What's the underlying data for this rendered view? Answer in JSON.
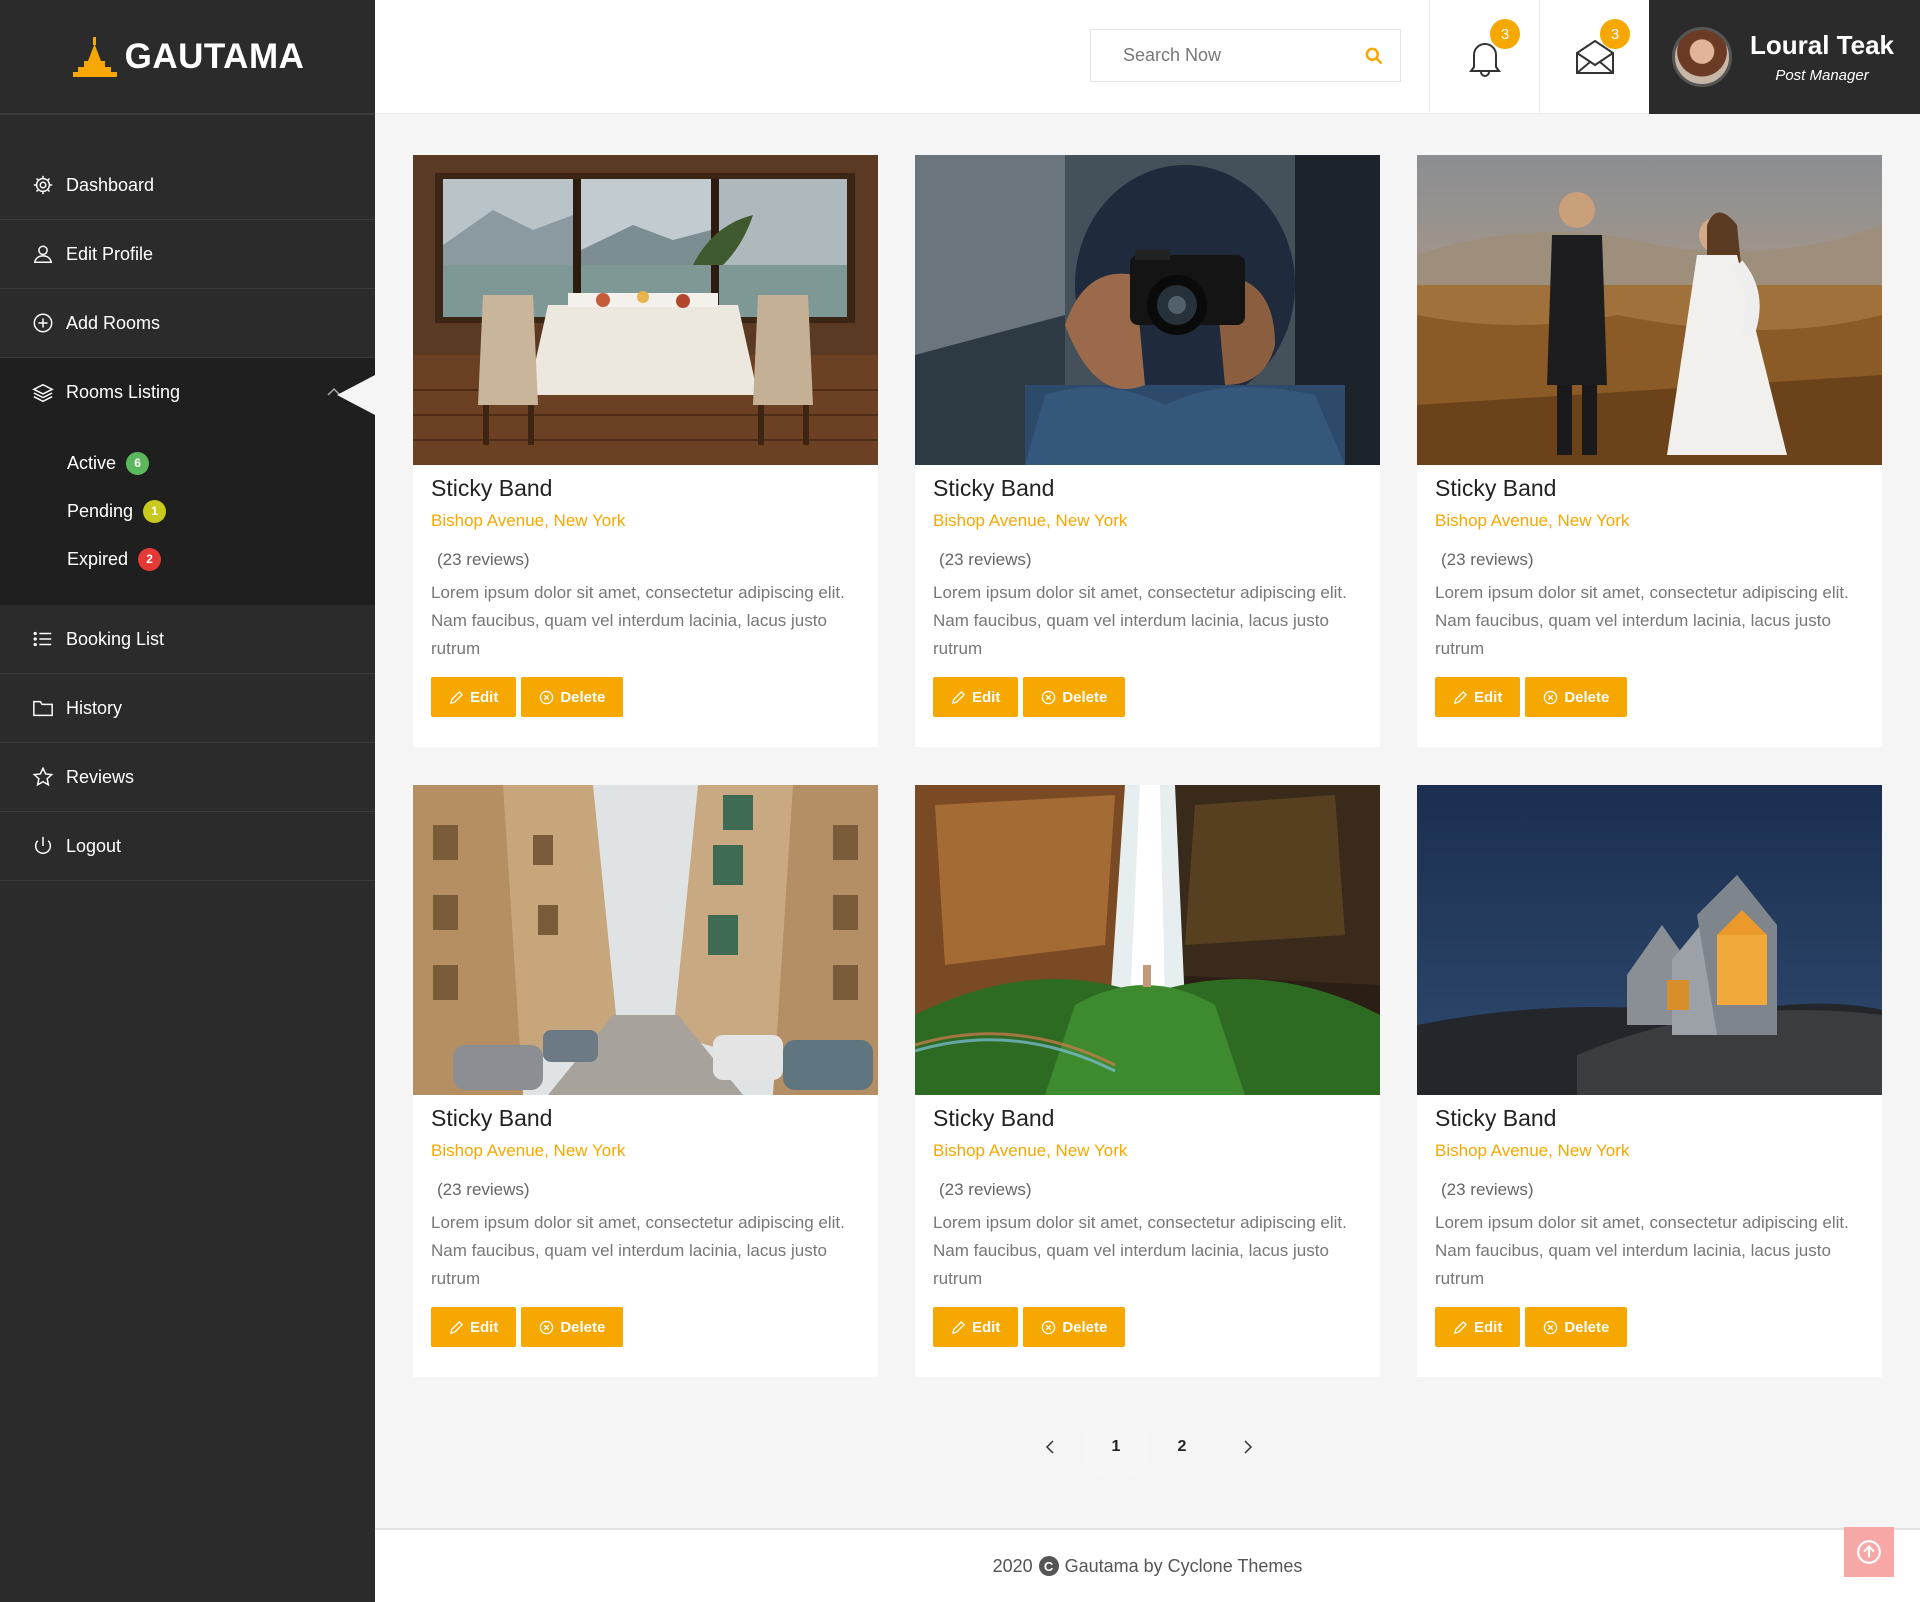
{
  "brand": {
    "name": "GAUTAMA",
    "accent": "#f7a800"
  },
  "sidebar": {
    "items": [
      {
        "label": "Dashboard",
        "icon": "gear-icon"
      },
      {
        "label": "Edit Profile",
        "icon": "user-icon"
      },
      {
        "label": "Add Rooms",
        "icon": "plus-circle-icon"
      },
      {
        "label": "Rooms Listing",
        "icon": "layers-icon"
      },
      {
        "label": "Booking List",
        "icon": "list-icon"
      },
      {
        "label": "History",
        "icon": "folder-icon"
      },
      {
        "label": "Reviews",
        "icon": "star-icon"
      },
      {
        "label": "Logout",
        "icon": "power-icon"
      }
    ],
    "sub_items": [
      {
        "label": "Active",
        "count": "6",
        "color": "#5cb85c"
      },
      {
        "label": "Pending",
        "count": "1",
        "color": "#c9c91e"
      },
      {
        "label": "Expired",
        "count": "2",
        "color": "#e53935"
      }
    ]
  },
  "header": {
    "search_placeholder": "Search Now",
    "notifications_count": "3",
    "messages_count": "3",
    "user_name": "Loural Teak",
    "user_role": "Post Manager"
  },
  "listings": [
    {
      "title": "Sticky Band",
      "address": "Bishop Avenue, New York",
      "reviews": "(23 reviews)",
      "description": "Lorem ipsum dolor sit amet, consectetur adipiscing elit. Nam faucibus, quam vel interdum lacinia, lacus justo rutrum",
      "image": "restaurant-window"
    },
    {
      "title": "Sticky Band",
      "address": "Bishop Avenue, New York",
      "reviews": "(23 reviews)",
      "description": "Lorem ipsum dolor sit amet, consectetur adipiscing elit. Nam faucibus, quam vel interdum lacinia, lacus justo rutrum",
      "image": "photographer"
    },
    {
      "title": "Sticky Band",
      "address": "Bishop Avenue, New York",
      "reviews": "(23 reviews)",
      "description": "Lorem ipsum dolor sit amet, consectetur adipiscing elit. Nam faucibus, quam vel interdum lacinia, lacus justo rutrum",
      "image": "couple-field"
    },
    {
      "title": "Sticky Band",
      "address": "Bishop Avenue, New York",
      "reviews": "(23 reviews)",
      "description": "Lorem ipsum dolor sit amet, consectetur adipiscing elit. Nam faucibus, quam vel interdum lacinia, lacus justo rutrum",
      "image": "city-street"
    },
    {
      "title": "Sticky Band",
      "address": "Bishop Avenue, New York",
      "reviews": "(23 reviews)",
      "description": "Lorem ipsum dolor sit amet, consectetur adipiscing elit. Nam faucibus, quam vel interdum lacinia, lacus justo rutrum",
      "image": "waterfall"
    },
    {
      "title": "Sticky Band",
      "address": "Bishop Avenue, New York",
      "reviews": "(23 reviews)",
      "description": "Lorem ipsum dolor sit amet, consectetur adipiscing elit. Nam faucibus, quam vel interdum lacinia, lacus justo rutrum",
      "image": "night-cabin"
    }
  ],
  "card_actions": {
    "edit": "Edit",
    "delete": "Delete"
  },
  "pagination": {
    "pages": [
      "1",
      "2"
    ],
    "current": "1"
  },
  "footer": {
    "year": "2020",
    "copyright_symbol": "C",
    "credit": "Gautama by Cyclone Themes"
  }
}
